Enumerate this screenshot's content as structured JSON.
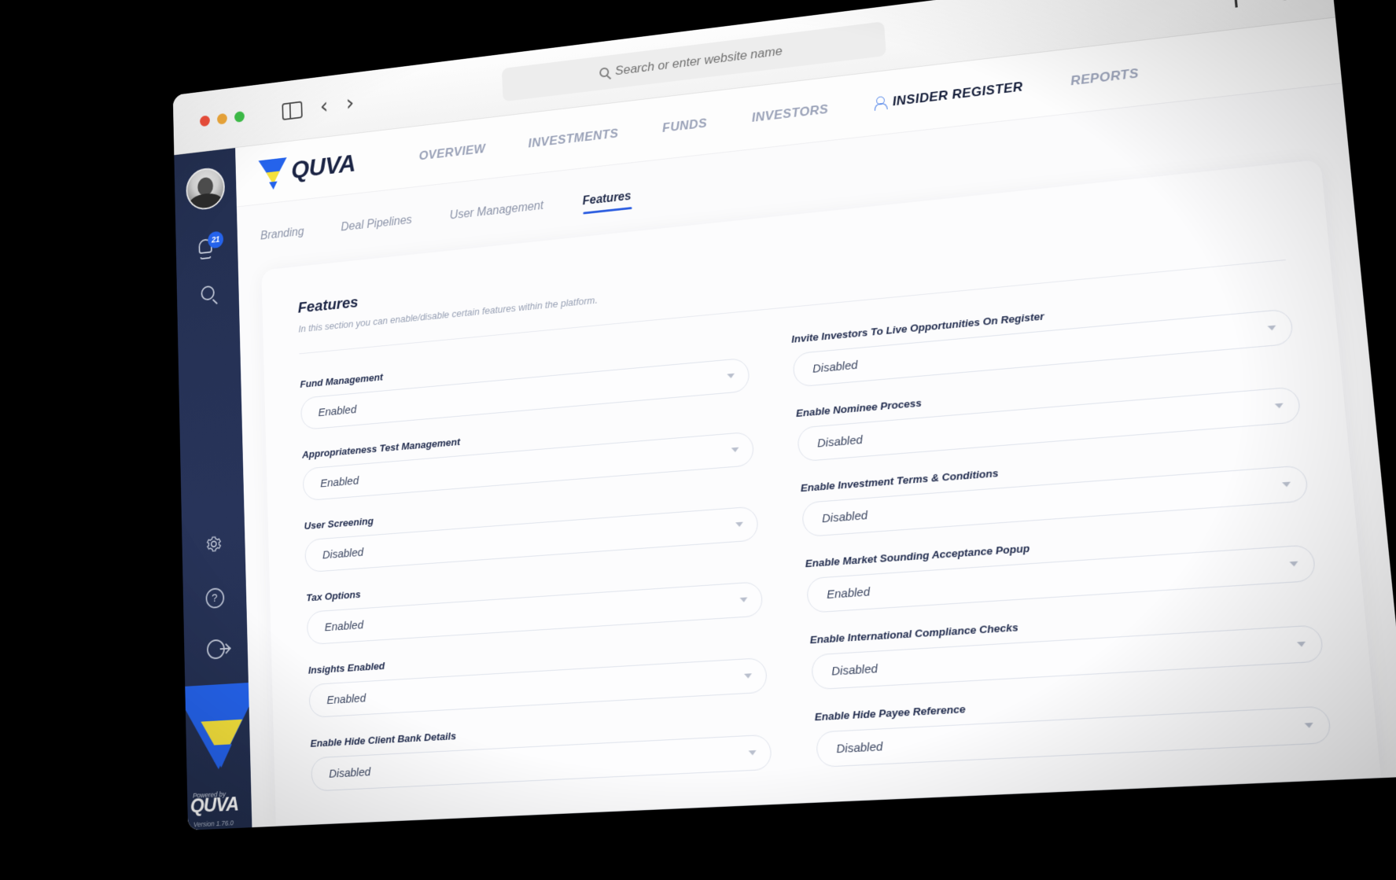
{
  "browser": {
    "traffic_lights": [
      "close",
      "minimize",
      "maximize"
    ],
    "sidebar_toggle": "sidebar-toggle",
    "back_label": "‹",
    "forward_label": "›",
    "url_placeholder": "Search or enter website name",
    "url_value": "",
    "new_tab_label": "+",
    "tabs_overview_label": "tabs"
  },
  "rail": {
    "avatar_alt": "User avatar",
    "notifications_count": "21",
    "icons": [
      "bell-icon",
      "search-icon",
      "gear-icon",
      "help-icon",
      "logout-icon"
    ],
    "powered_by": "Powered by",
    "brand": "QUVA",
    "version": "Version 1.76.0"
  },
  "topnav": {
    "brand": "QUVA",
    "items": [
      {
        "label": "OVERVIEW",
        "active": false
      },
      {
        "label": "INVESTMENTS",
        "active": false
      },
      {
        "label": "FUNDS",
        "active": false
      },
      {
        "label": "INVESTORS",
        "active": false
      },
      {
        "label": "INSIDER REGISTER",
        "active": true
      },
      {
        "label": "REPORTS",
        "active": false
      }
    ]
  },
  "subtabs": [
    {
      "label": "Branding",
      "active": false
    },
    {
      "label": "Deal Pipelines",
      "active": false
    },
    {
      "label": "User Management",
      "active": false
    },
    {
      "label": "Features",
      "active": true
    }
  ],
  "section": {
    "title": "Features",
    "description": "In this section you can enable/disable certain features within the platform."
  },
  "options": [
    "Enabled",
    "Disabled"
  ],
  "fields": [
    {
      "label": "Fund Management",
      "value": "Enabled"
    },
    {
      "label": "Invite Investors To Live Opportunities On Register",
      "value": "Disabled"
    },
    {
      "label": "Appropriateness Test Management",
      "value": "Enabled"
    },
    {
      "label": "Enable Nominee Process",
      "value": "Disabled"
    },
    {
      "label": "User Screening",
      "value": "Disabled"
    },
    {
      "label": "Enable Investment Terms & Conditions",
      "value": "Disabled"
    },
    {
      "label": "Tax Options",
      "value": "Enabled"
    },
    {
      "label": "Enable Market Sounding Acceptance Popup",
      "value": "Enabled"
    },
    {
      "label": "Insights Enabled",
      "value": "Enabled"
    },
    {
      "label": "Enable International Compliance Checks",
      "value": "Disabled"
    },
    {
      "label": "Enable Hide Client Bank Details",
      "value": "Disabled"
    },
    {
      "label": "Enable Hide Payee Reference",
      "value": "Disabled"
    }
  ],
  "colors": {
    "brand_blue": "#2563eb",
    "brand_yellow": "#f5e13c",
    "rail_navy": "#28345a",
    "accent_underline": "#2d5ee0",
    "badge_blue": "#2563eb"
  }
}
